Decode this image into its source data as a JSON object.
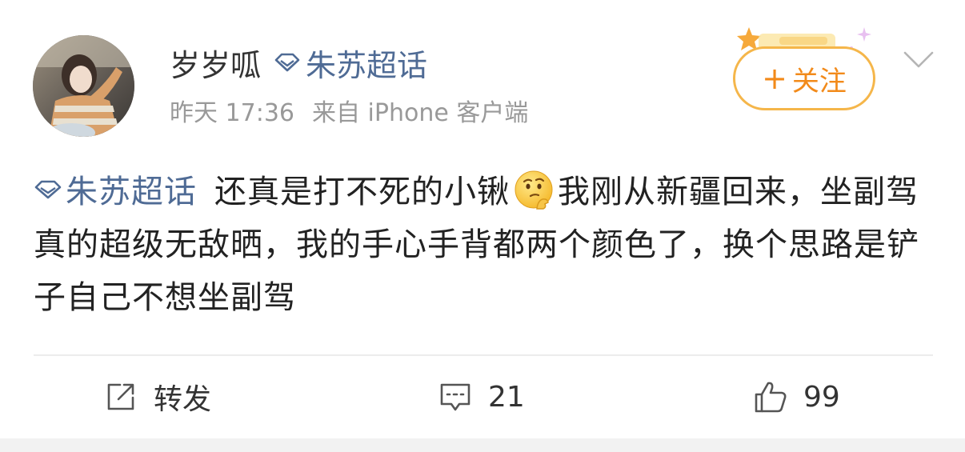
{
  "author": {
    "name": "岁岁呱",
    "supertopic": "朱苏超话",
    "time": "昨天 17:36",
    "source": "来自 iPhone 客户端"
  },
  "follow": {
    "label": "关注",
    "plus": "+"
  },
  "post": {
    "topic": "朱苏超话",
    "text_before_emoji": "还真是打不死的小锹",
    "text_after_emoji": "我刚从新疆回来，坐副驾真的超级无敌晒，我的手心手背都两个颜色了，换个思路是铲子自己不想坐副驾"
  },
  "actions": {
    "repost_label": "转发",
    "comment_count": "21",
    "like_count": "99"
  },
  "colors": {
    "topic_blue": "#4f6b95",
    "follow_orange": "#f28a1a",
    "follow_border": "#f5b64a",
    "meta_gray": "#999999",
    "text_dark": "#222222"
  },
  "icons": {
    "supertopic": "diamond-icon",
    "emoji": "thinking-emoji-icon",
    "repost": "repost-edit-icon",
    "comment": "comment-icon",
    "like": "thumbs-up-icon",
    "menu": "chevron-down-icon"
  }
}
